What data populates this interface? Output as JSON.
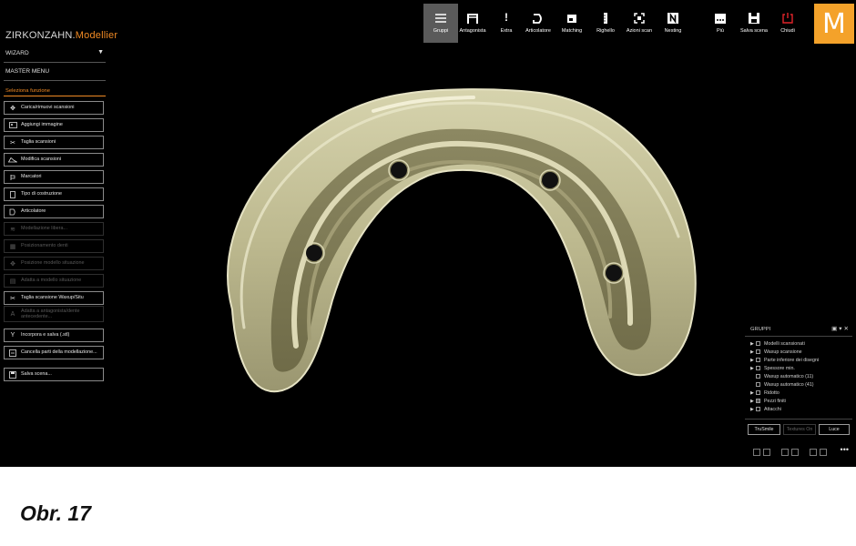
{
  "brand": {
    "part1": "ZIRKONZAHN.",
    "part2": "Modellier"
  },
  "left_panel": {
    "wizard": "WIZARD",
    "master_menu": "MASTER MENU",
    "select_function": "Seleziona funzione",
    "buttons": [
      {
        "label": "Carica/rimuovi scansioni",
        "icon": "move-icon",
        "enabled": true
      },
      {
        "label": "Aggiungi immagine",
        "icon": "image-icon",
        "enabled": true
      },
      {
        "label": "Taglia scansioni",
        "icon": "scissors-icon",
        "enabled": true
      },
      {
        "label": "Modifica scansioni",
        "icon": "edit-scan-icon",
        "enabled": true
      },
      {
        "label": "Marcatori",
        "icon": "marker-icon",
        "enabled": true
      },
      {
        "label": "Tipo di costruzione",
        "icon": "construction-icon",
        "enabled": true
      },
      {
        "label": "Articolatore",
        "icon": "articulator-icon",
        "enabled": true
      },
      {
        "label": "Modellazione libera...",
        "icon": "freeform-icon",
        "enabled": false
      },
      {
        "label": "Posizionamento denti",
        "icon": "teeth-position-icon",
        "enabled": false
      },
      {
        "label": "Posizione modello situazione",
        "icon": "position-icon",
        "enabled": false
      },
      {
        "label": "Adatta a modello situazione",
        "icon": "adapt-icon",
        "enabled": false
      },
      {
        "label": "Taglia scansione Waxup/Situ",
        "icon": "scissors-icon",
        "enabled": true
      },
      {
        "label": "Adatta a antagonista/dente antecedente...",
        "icon": "text-icon",
        "enabled": false
      },
      {
        "label": "Incorpora e salva (.stl)",
        "icon": "merge-icon",
        "enabled": true
      },
      {
        "label": "Cancella parti della modellazione...",
        "icon": "delete-icon",
        "enabled": true
      },
      {
        "label": "Salva scena...",
        "icon": "save-icon",
        "enabled": true
      }
    ]
  },
  "toolbar": [
    {
      "label": "Gruppi",
      "icon": "menu-icon",
      "active": true
    },
    {
      "label": "Antagonista",
      "icon": "antagonist-icon",
      "active": false
    },
    {
      "label": "Extra",
      "icon": "exclamation-icon",
      "active": false
    },
    {
      "label": "Articolatore",
      "icon": "articulator-icon",
      "active": false
    },
    {
      "label": "Matching",
      "icon": "matching-icon",
      "active": false
    },
    {
      "label": "Righello",
      "icon": "ruler-icon",
      "active": false
    },
    {
      "label": "Azioni scan",
      "icon": "scan-actions-icon",
      "active": false
    },
    {
      "label": "Nesting",
      "icon": "nesting-icon",
      "active": false
    },
    {
      "label": "Più",
      "icon": "more-icon",
      "active": false
    },
    {
      "label": "Salva scena",
      "icon": "save-icon",
      "active": false
    },
    {
      "label": "Chiudi",
      "icon": "power-icon",
      "active": false
    }
  ],
  "logo_letter": "M",
  "groups_panel": {
    "title": "GRUPPI",
    "items": [
      {
        "label": "Modelli scansionati",
        "arrow": true,
        "checked": false
      },
      {
        "label": "Waxup scansione",
        "arrow": true,
        "checked": false
      },
      {
        "label": "Parte inferiore dei disegni",
        "arrow": true,
        "checked": false
      },
      {
        "label": "Spessore min.",
        "arrow": true,
        "checked": false
      },
      {
        "label": "Waxup automatico (11)",
        "arrow": false,
        "checked": false
      },
      {
        "label": "Waxup automatico (41)",
        "arrow": false,
        "checked": false
      },
      {
        "label": "Ridotto",
        "arrow": true,
        "checked": false
      },
      {
        "label": "Pezzi finiti",
        "arrow": true,
        "checked": true
      },
      {
        "label": "Attacchi",
        "arrow": true,
        "checked": false
      }
    ],
    "buttons": [
      {
        "label": "TruSmile",
        "enabled": true
      },
      {
        "label": "Textures On",
        "enabled": false
      },
      {
        "label": "Luce",
        "enabled": true
      }
    ]
  },
  "caption": "Obr. 17"
}
